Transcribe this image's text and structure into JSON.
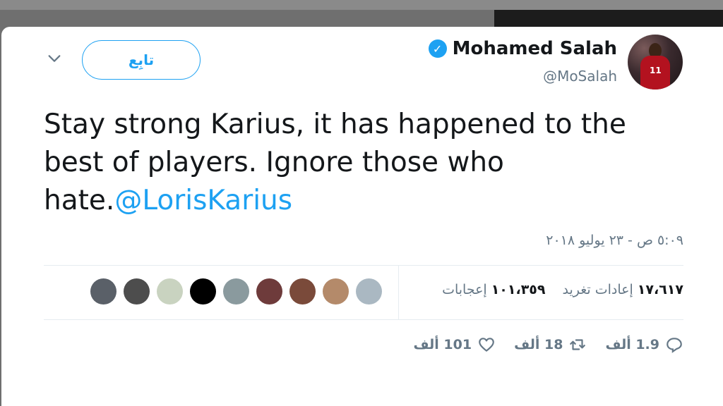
{
  "tweet": {
    "author": {
      "display_name": "Mohamed Salah",
      "handle": "@MoSalah",
      "verified_icon": "verified-badge-icon",
      "avatar_jersey_number": "11"
    },
    "follow_label": "تابِع",
    "text_plain": "Stay strong Karius, it has happened to the best of players. Ignore those who hate.",
    "mention": "@LorisKarius",
    "timestamp": "٥:٠٩ ص - ٢٣ يوليو ٢٠١٨",
    "stats": {
      "retweets_count": "١٧،٦١٧",
      "retweets_label": "إعادات تغريد",
      "likes_count": "١٠١،٣٥٩",
      "likes_label": "إعجابات"
    },
    "likers_avatars": [
      {
        "color": "#5a6068"
      },
      {
        "color": "#4d4d4d"
      },
      {
        "color": "#c9d3c0"
      },
      {
        "color": "#000000"
      },
      {
        "color": "#8a9a9e"
      },
      {
        "color": "#6e3b3b"
      },
      {
        "color": "#7a4a3a"
      },
      {
        "color": "#b48a6a"
      },
      {
        "color": "#aab8c2"
      }
    ],
    "actions": {
      "replies": "1.9 ألف",
      "retweets": "18 ألف",
      "likes": "101 ألف"
    }
  },
  "colors": {
    "accent": "#1da1f2",
    "text": "#14171a",
    "muted": "#657786"
  }
}
